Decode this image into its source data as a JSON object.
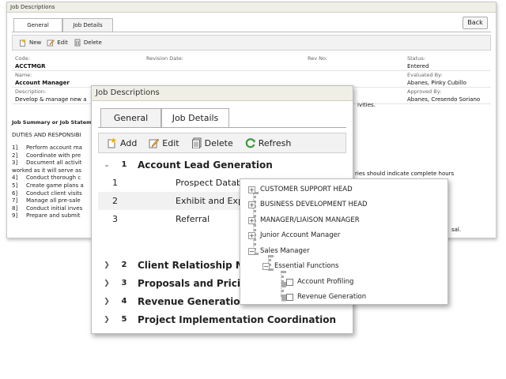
{
  "back_window": {
    "title": "Job Descriptions",
    "tabs": [
      "General",
      "Job Details"
    ],
    "back_label": "Back",
    "toolbar": {
      "new": "New",
      "edit": "Edit",
      "delete": "Delete"
    },
    "fields": {
      "code_label": "Code:",
      "code_value": "ACCTMGR",
      "revision_label": "Revision Date:",
      "revno_label": "Rev No:",
      "status_label": "Status:",
      "status_value": "Entered",
      "name_label": "Name:",
      "name_value": "Account Manager",
      "evaluated_label": "Evaluated By:",
      "evaluated_value": "Abanes, Pinky Cubillo",
      "description_label": "Description:",
      "description_value": "Develop & manage new a",
      "approved_label": "Approved By:",
      "approved_value": "Abanes, Cresendo Soriano"
    },
    "summary_heading": "Job Summary or Job Stateme",
    "duties_heading": "DUTIES AND RESPONSIBI",
    "duties": [
      {
        "num": "1]",
        "text": "Perform account ma"
      },
      {
        "num": "2]",
        "text": "Coordinate with pre"
      },
      {
        "num": "3]",
        "text": "Document all activit"
      },
      {
        "num": "",
        "text": "worked as it will serve as"
      },
      {
        "num": "4]",
        "text": "Conduct thorough c"
      },
      {
        "num": "5]",
        "text": "Create game plans a"
      },
      {
        "num": "6]",
        "text": "Conduct client visits"
      },
      {
        "num": "7]",
        "text": "Manage all pre-sale"
      },
      {
        "num": "8]",
        "text": "Conduct initial inves"
      },
      {
        "num": "9]",
        "text": "Prepare and submit"
      }
    ],
    "peek": {
      "desc_right": "ivities.",
      "duties_right": "ries should indicate complete hours",
      "sal_right": "sal."
    }
  },
  "middle_window": {
    "title": "Job Descriptions",
    "tabs": [
      "General",
      "Job Details"
    ],
    "toolbar": {
      "add": "Add",
      "edit": "Edit",
      "delete": "Delete",
      "refresh": "Refresh"
    },
    "groups": [
      {
        "num": "1",
        "title": "Account Lead Generation",
        "expanded": true,
        "items": [
          {
            "num": "1",
            "title": "Prospect Databa"
          },
          {
            "num": "2",
            "title": "Exhibit and Expo"
          },
          {
            "num": "3",
            "title": "Referral"
          }
        ]
      },
      {
        "num": "2",
        "title": "Client Relatioship M"
      },
      {
        "num": "3",
        "title": "Proposals and Pricin"
      },
      {
        "num": "4",
        "title": "Revenue Generation"
      },
      {
        "num": "5",
        "title": "Project Implementation Coordination"
      }
    ]
  },
  "tree_popup": {
    "nodes": [
      {
        "label": "CUSTOMER SUPPORT HEAD",
        "state": "collapsed"
      },
      {
        "label": "BUSINESS DEVELOPMENT HEAD",
        "state": "collapsed"
      },
      {
        "label": "MANAGER/LIAISON MANAGER",
        "state": "collapsed"
      },
      {
        "label": "Junior Account Manager",
        "state": "collapsed"
      },
      {
        "label": "Sales Manager",
        "state": "expanded"
      },
      {
        "label": "Essential Functions",
        "state": "expanded"
      },
      {
        "label": "Account Profiling",
        "state": "unchecked"
      },
      {
        "label": "Revenue Generation",
        "state": "unchecked"
      }
    ]
  },
  "colors": {
    "titlebar": "#f0efe6",
    "toolbar": "#f2f2f2",
    "refresh_green": "#3c9a3c"
  }
}
